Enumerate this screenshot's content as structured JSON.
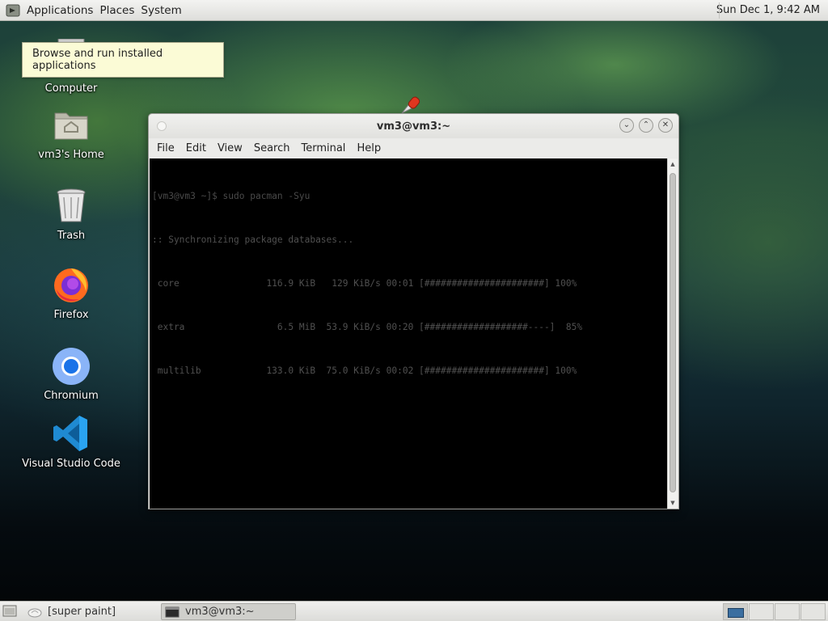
{
  "top_panel": {
    "menus": [
      "Applications",
      "Places",
      "System"
    ],
    "clock": "Sun Dec 1,  9:42 AM"
  },
  "tooltip": {
    "text": "Browse and run installed applications"
  },
  "desktop_icons": [
    {
      "label": "Computer",
      "icon": "computer-icon"
    },
    {
      "label": "vm3's Home",
      "icon": "home-folder-icon"
    },
    {
      "label": "Trash",
      "icon": "trash-icon"
    },
    {
      "label": "Firefox",
      "icon": "firefox-icon"
    },
    {
      "label": "Chromium",
      "icon": "chromium-icon"
    },
    {
      "label": "Visual Studio Code",
      "icon": "vscode-icon"
    }
  ],
  "terminal": {
    "title": "vm3@vm3:~",
    "menu": [
      "File",
      "Edit",
      "View",
      "Search",
      "Terminal",
      "Help"
    ],
    "lines": [
      "[vm3@vm3 ~]$ sudo pacman -Syu",
      ":: Synchronizing package databases...",
      " core                116.9 KiB   129 KiB/s 00:01 [######################] 100%",
      " extra                 6.5 MiB  53.9 KiB/s 00:20 [###################----]  85%",
      " multilib            133.0 KiB  75.0 KiB/s 00:02 [######################] 100%"
    ]
  },
  "taskbar": {
    "tasks": [
      {
        "label": "[super paint]",
        "icon": "paint-icon"
      },
      {
        "label": "vm3@vm3:~",
        "icon": "terminal-icon"
      }
    ],
    "workspaces": 4,
    "active_workspace": 1
  },
  "colors": {
    "panel": "#e6e6e3",
    "tooltip": "#fbfbd6",
    "terminal_bg": "#000000",
    "terminal_text": "#505050"
  }
}
